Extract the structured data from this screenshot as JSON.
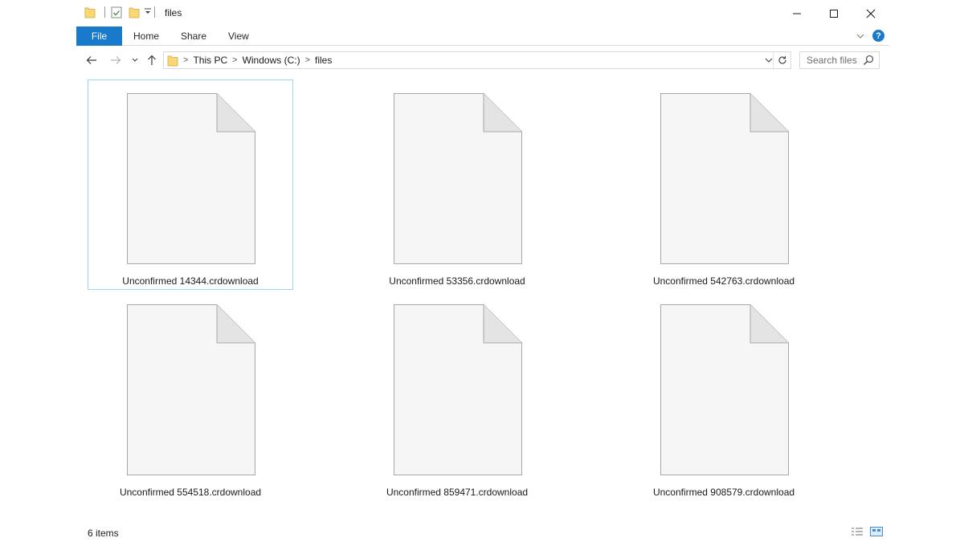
{
  "window": {
    "title": "files",
    "controls": {
      "minimize": "—",
      "maximize": "☐",
      "close": "✕"
    }
  },
  "ribbon": {
    "tabs": [
      {
        "label": "File",
        "active": true
      },
      {
        "label": "Home"
      },
      {
        "label": "Share"
      },
      {
        "label": "View"
      }
    ],
    "expand_icon": "chevron-down-icon",
    "help_label": "?"
  },
  "address": {
    "crumbs": [
      "This PC",
      "Windows (C:)",
      "files"
    ],
    "separator": ">"
  },
  "search": {
    "placeholder": "Search files"
  },
  "files": [
    {
      "name": "Unconfirmed 14344.crdownload",
      "selected": true
    },
    {
      "name": "Unconfirmed 53356.crdownload",
      "selected": false
    },
    {
      "name": "Unconfirmed 542763.crdownload",
      "selected": false
    },
    {
      "name": "Unconfirmed 554518.crdownload",
      "selected": false
    },
    {
      "name": "Unconfirmed 859471.crdownload",
      "selected": false
    },
    {
      "name": "Unconfirmed 908579.crdownload",
      "selected": false
    }
  ],
  "status": {
    "item_count": "6 items"
  },
  "colors": {
    "accent": "#1979ca",
    "selection_border": "#99d1ff",
    "folder": "#f8d775"
  }
}
